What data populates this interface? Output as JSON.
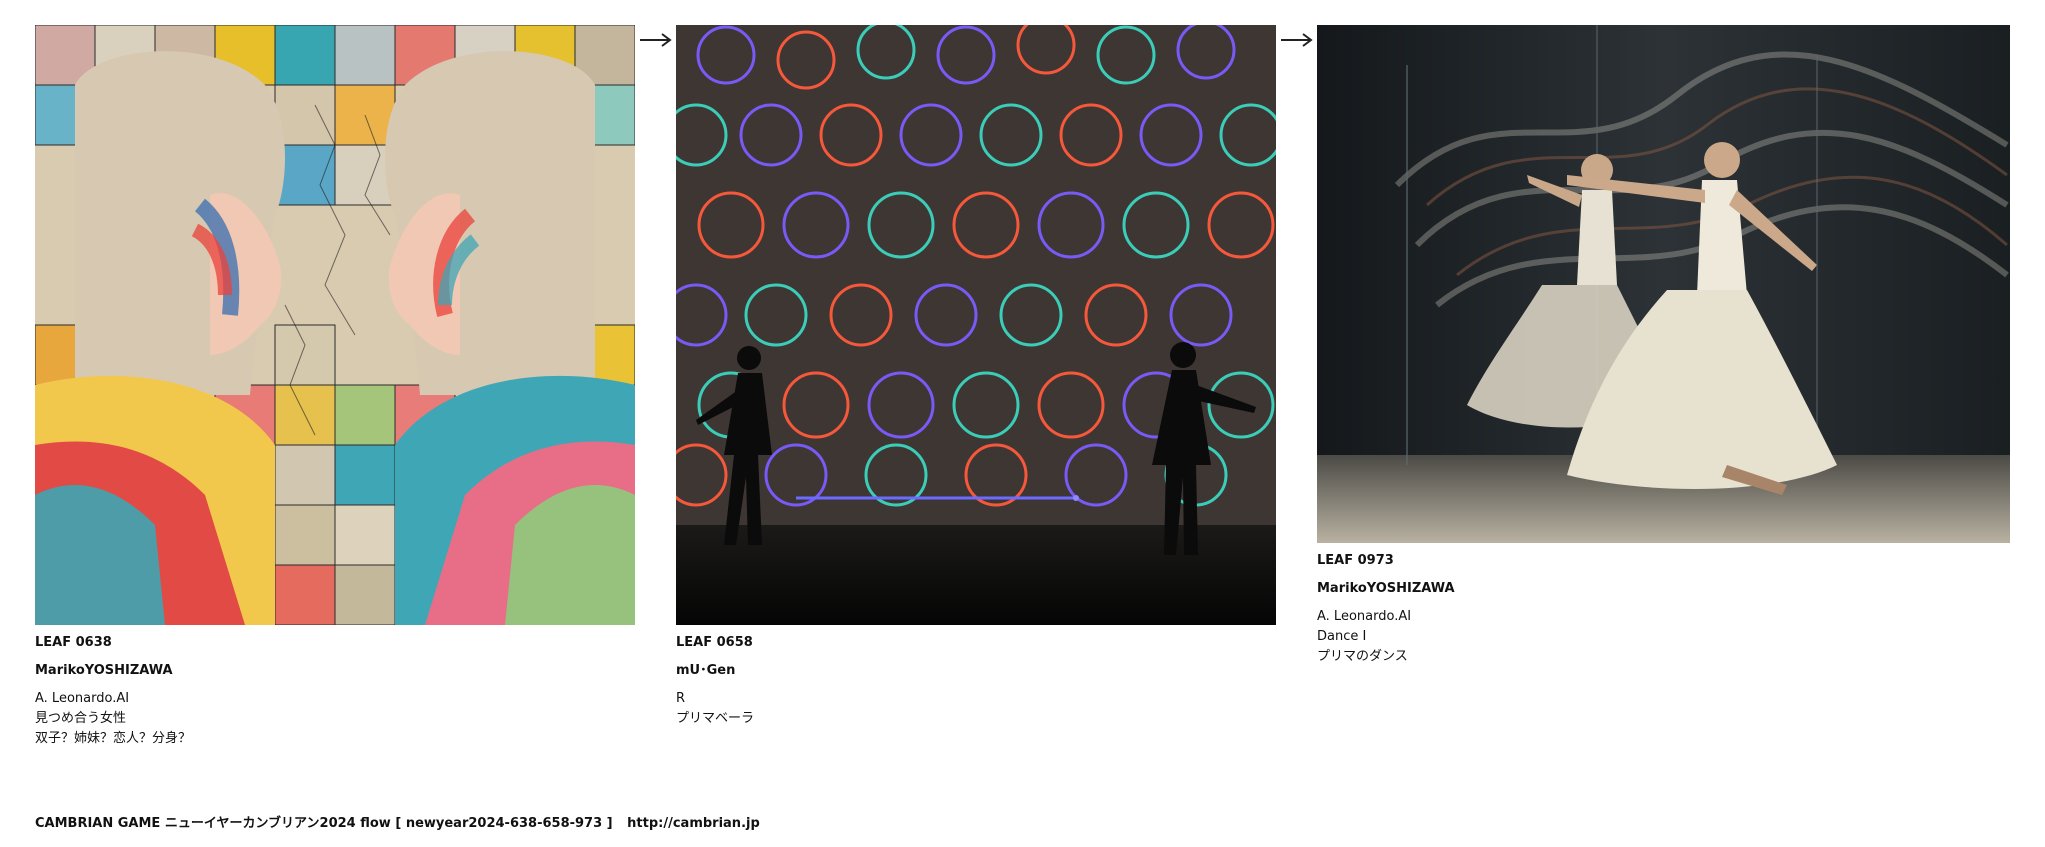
{
  "leaves": [
    {
      "id_label": "LEAF 0638",
      "author": "MarikoYOSHIZAWA",
      "lines": [
        "A. Leonardo.AI",
        "見つめ合う女性",
        "双子？姉妹？恋人？分身？"
      ],
      "image": {
        "desc": "two-women-mosaic",
        "colors": [
          "#e74c3c",
          "#f1c40f",
          "#3aa6b9",
          "#d7c9ad",
          "#9dc36b"
        ]
      }
    },
    {
      "id_label": "LEAF 0658",
      "author": "mU･Gen",
      "lines": [
        "R",
        "プリマベーラ"
      ],
      "image": {
        "desc": "dancers-light-circles",
        "colors": [
          "#3a3430",
          "#7a5cff",
          "#ff5a3c",
          "#3cd6c1"
        ]
      }
    },
    {
      "id_label": "LEAF 0973",
      "author": "MarikoYOSHIZAWA",
      "lines": [
        "A. Leonardo.AI",
        "Dance I",
        "プリマのダンス"
      ],
      "image": {
        "desc": "ballerinas-motion",
        "colors": [
          "#1f2428",
          "#9a9a8f",
          "#e7e2d2",
          "#7a5a44"
        ]
      }
    }
  ],
  "footer": {
    "title": "CAMBRIAN GAME ニューイヤーカンブリアン2024 flow [ newyear2024-638-658-973 ]",
    "url": "http://cambrian.jp"
  }
}
